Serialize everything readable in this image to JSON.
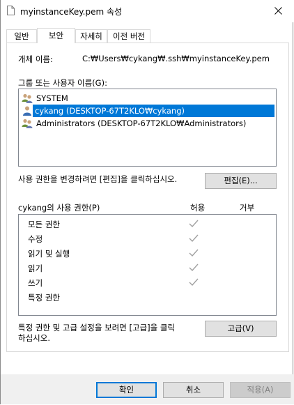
{
  "window": {
    "title": "myinstanceKey.pem 속성",
    "close_icon": "close-icon",
    "file_icon": "file-icon"
  },
  "tabs": [
    {
      "label": "일반",
      "active": false
    },
    {
      "label": "보안",
      "active": true
    },
    {
      "label": "자세히",
      "active": false
    },
    {
      "label": "이전 버전",
      "active": false
    }
  ],
  "security": {
    "object_name_label": "개체 이름:",
    "object_name_value": "C:₩Users₩cykang₩.ssh₩myinstanceKey.pem",
    "group_label": "그룹 또는 사용자 이름(G):",
    "users": [
      {
        "label": "SYSTEM",
        "icon": "users-group-icon",
        "selected": false
      },
      {
        "label": "cykang (DESKTOP-67T2KLO₩cykang)",
        "icon": "user-icon",
        "selected": true
      },
      {
        "label": "Administrators (DESKTOP-67T2KLO₩Administrators)",
        "icon": "users-group-icon",
        "selected": false
      }
    ],
    "change_perm_text": "사용 권한을 변경하려면 [편집]을 클릭하십시오.",
    "edit_button": "편집(E)...",
    "perm_title": "cykang의 사용 권한(P)",
    "allow_header": "허용",
    "deny_header": "거부",
    "permissions": [
      {
        "name": "모든 권한",
        "allow": true
      },
      {
        "name": "수정",
        "allow": true
      },
      {
        "name": "읽기 및 실행",
        "allow": true
      },
      {
        "name": "읽기",
        "allow": true
      },
      {
        "name": "쓰기",
        "allow": true
      },
      {
        "name": "특정 권한",
        "allow": false
      }
    ],
    "advanced_text": "특정 권한 및 고급 설정을 보려면 [고급]을 클릭\n하십시오.",
    "advanced_text_line1": "특정 권한 및 고급 설정을 보려면 [고급]을 클릭",
    "advanced_text_line2": "하십시오.",
    "advanced_button": "고급(V)"
  },
  "footer": {
    "ok": "확인",
    "cancel": "취소",
    "apply": "적용(A)"
  },
  "colors": {
    "selection": "#0078d7",
    "check_gray": "#a0a0a0"
  }
}
